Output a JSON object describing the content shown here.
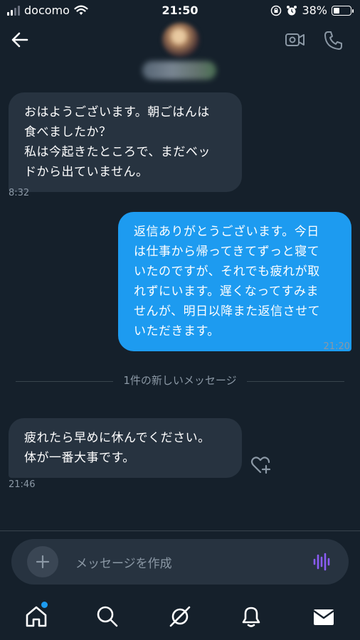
{
  "status_bar": {
    "carrier": "docomo",
    "time": "21:50",
    "battery_percent": "38%",
    "battery_level": 0.38
  },
  "header": {
    "back_icon": "arrow-left-icon",
    "video_icon": "video-call-icon",
    "phone_icon": "phone-icon"
  },
  "messages": [
    {
      "direction": "incoming",
      "text": "おはようございます。朝ごはんは\n食べましたか？\n私は今起きたところで、まだベッ\nドから出ていません。",
      "time": "8:32"
    },
    {
      "direction": "outgoing",
      "text": "返信ありがとうございます。今日\nは仕事から帰ってきてずっと寝て\nいたのですが、それでも疲れが取\nれずにいます。遅くなってすみま\nせんが、明日以降また返信させて\nいただきます。",
      "time": "21:20"
    },
    {
      "direction": "incoming",
      "text": "疲れたら早めに休んでください。\n体が一番大事です。",
      "time": "21:46"
    }
  ],
  "divider_label": "1件の新しいメッセージ",
  "composer": {
    "placeholder": "メッセージを作成"
  },
  "tabbar": {
    "items": [
      "home-icon",
      "search-icon",
      "spaces-icon",
      "notifications-icon",
      "messages-icon"
    ]
  },
  "colors": {
    "background": "#15202b",
    "incoming_bubble": "#273340",
    "outgoing_bubble": "#1d9bf0",
    "accent": "#1d9bf0",
    "voice_accent": "#8b5cf6"
  }
}
